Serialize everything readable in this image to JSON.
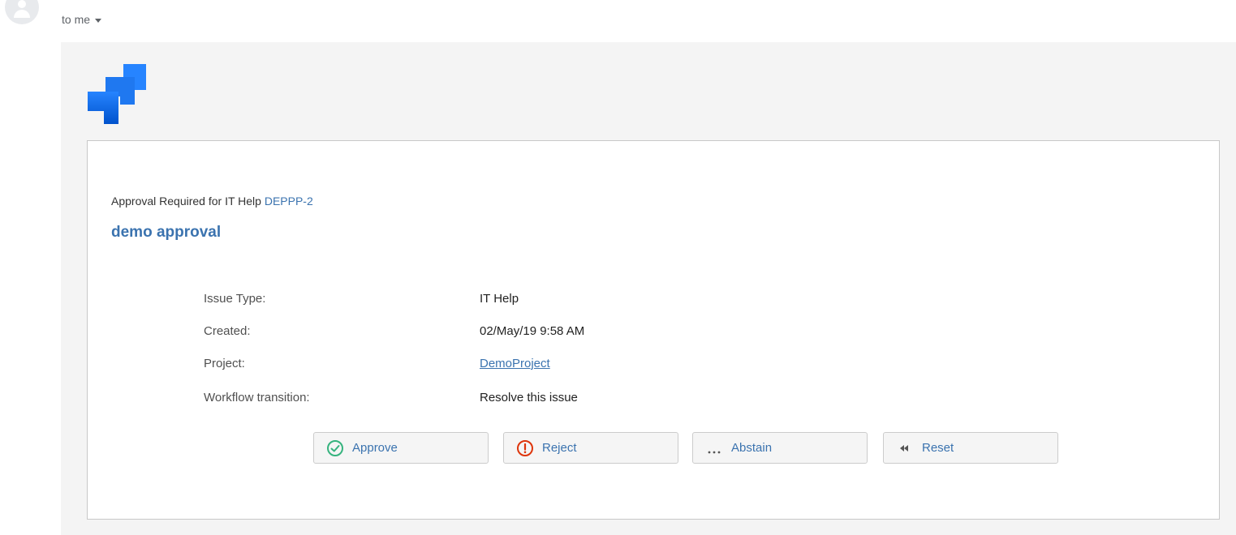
{
  "header": {
    "recipient_label": "to me"
  },
  "email": {
    "approval_prefix": "Approval Required for IT Help",
    "issue_key": "DEPPP-2",
    "issue_title": "demo approval",
    "fields": [
      {
        "label": "Issue Type:",
        "value": "IT Help"
      },
      {
        "label": "Created:",
        "value": "02/May/19 9:58 AM"
      },
      {
        "label": "Project:",
        "value": "DemoProject"
      },
      {
        "label": "Workflow transition:",
        "value": "Resolve this issue"
      }
    ],
    "actions": {
      "approve": "Approve",
      "reject": "Reject",
      "abstain": "Abstain",
      "reset": "Reset"
    }
  },
  "colors": {
    "link_blue": "#3b73af",
    "approve_green": "#36b37e",
    "reject_red": "#de350b",
    "jira_blue": "#2684ff",
    "panel_bg": "#f4f4f4"
  },
  "icons": {
    "logo": "jira-logo-icon",
    "approve": "check-circle-icon",
    "reject": "exclamation-circle-icon",
    "abstain": "ellipsis-icon",
    "reset": "rewind-icon",
    "recipient_menu": "caret-down-icon"
  }
}
